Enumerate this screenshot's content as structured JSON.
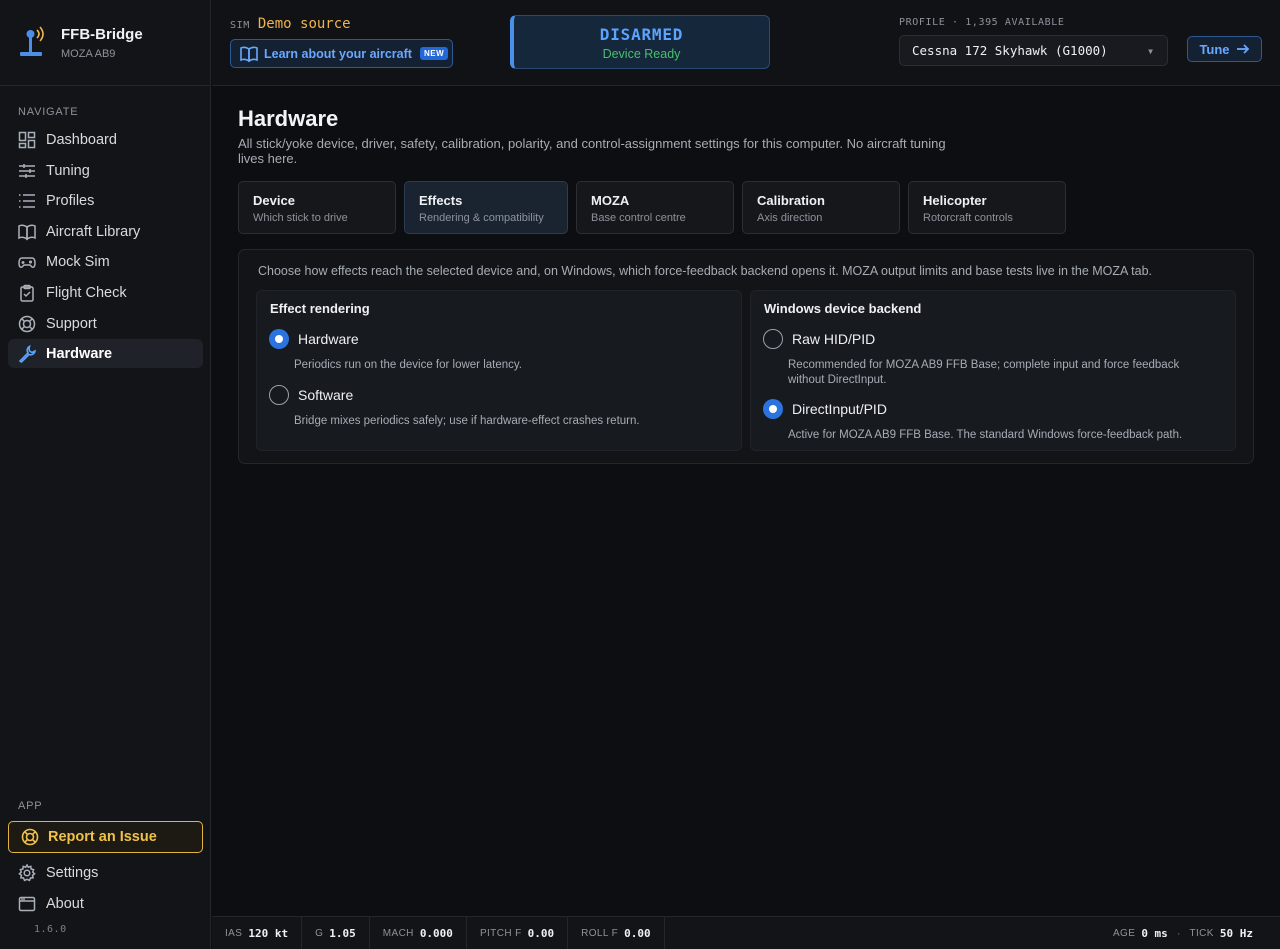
{
  "app": {
    "name": "FFB-Bridge",
    "device": "MOZA AB9",
    "version": "1.6.0"
  },
  "nav": {
    "heading": "NAVIGATE",
    "items": [
      {
        "label": "Dashboard",
        "icon": "dashboard-icon"
      },
      {
        "label": "Tuning",
        "icon": "sliders-icon"
      },
      {
        "label": "Profiles",
        "icon": "list-icon"
      },
      {
        "label": "Aircraft Library",
        "icon": "book-icon"
      },
      {
        "label": "Mock Sim",
        "icon": "gamepad-icon"
      },
      {
        "label": "Flight Check",
        "icon": "clipboard-icon"
      },
      {
        "label": "Support",
        "icon": "lifebuoy-icon"
      },
      {
        "label": "Hardware",
        "icon": "wrench-icon",
        "active": true
      }
    ],
    "app_heading": "APP",
    "report_label": "Report an Issue",
    "settings_label": "Settings",
    "about_label": "About"
  },
  "topbar": {
    "sim_label": "SIM",
    "sim_value": "Demo source",
    "learn_label": "Learn about your aircraft",
    "new_badge": "NEW",
    "status_title": "DISARMED",
    "status_sub": "Device Ready",
    "profile_label": "PROFILE · 1,395 AVAILABLE",
    "profile_value": "Cessna 172 Skyhawk (G1000)",
    "tune_label": "Tune"
  },
  "page": {
    "title": "Hardware",
    "description": "All stick/yoke device, driver, safety, calibration, polarity, and control-assignment settings for this computer. No aircraft tuning lives here.",
    "tabs": [
      {
        "title": "Device",
        "sub": "Which stick to drive"
      },
      {
        "title": "Effects",
        "sub": "Rendering & compatibility",
        "active": true
      },
      {
        "title": "MOZA",
        "sub": "Base control centre"
      },
      {
        "title": "Calibration",
        "sub": "Axis direction"
      },
      {
        "title": "Helicopter",
        "sub": "Rotorcraft controls"
      }
    ],
    "panel_description": "Choose how effects reach the selected device and, on Windows, which force-feedback backend opens it. MOZA output limits and base tests live in the MOZA tab.",
    "rendering": {
      "title": "Effect rendering",
      "options": [
        {
          "label": "Hardware",
          "help": "Periodics run on the device for lower latency.",
          "checked": true
        },
        {
          "label": "Software",
          "help": "Bridge mixes periodics safely; use if hardware-effect crashes return.",
          "checked": false
        }
      ]
    },
    "backend": {
      "title": "Windows device backend",
      "options": [
        {
          "label": "Raw HID/PID",
          "help": "Recommended for MOZA AB9 FFB Base; complete input and force feedback without DirectInput.",
          "checked": false
        },
        {
          "label": "DirectInput/PID",
          "help": "Active for MOZA AB9 FFB Base. The standard Windows force-feedback path.",
          "checked": true
        }
      ]
    }
  },
  "footer": {
    "telemetry": [
      {
        "label": "IAS",
        "value": "120 kt"
      },
      {
        "label": "G",
        "value": "1.05"
      },
      {
        "label": "MACH",
        "value": "0.000"
      },
      {
        "label": "PITCH F",
        "value": "0.00"
      },
      {
        "label": "ROLL F",
        "value": "0.00"
      }
    ],
    "age_label": "AGE",
    "age_value": "0 ms",
    "tick_label": "TICK",
    "tick_value": "50 Hz"
  },
  "colors": {
    "accent": "#5aa3ff",
    "warning": "#f0c14b",
    "success": "#46c06b",
    "sim": "#f0b44c"
  }
}
